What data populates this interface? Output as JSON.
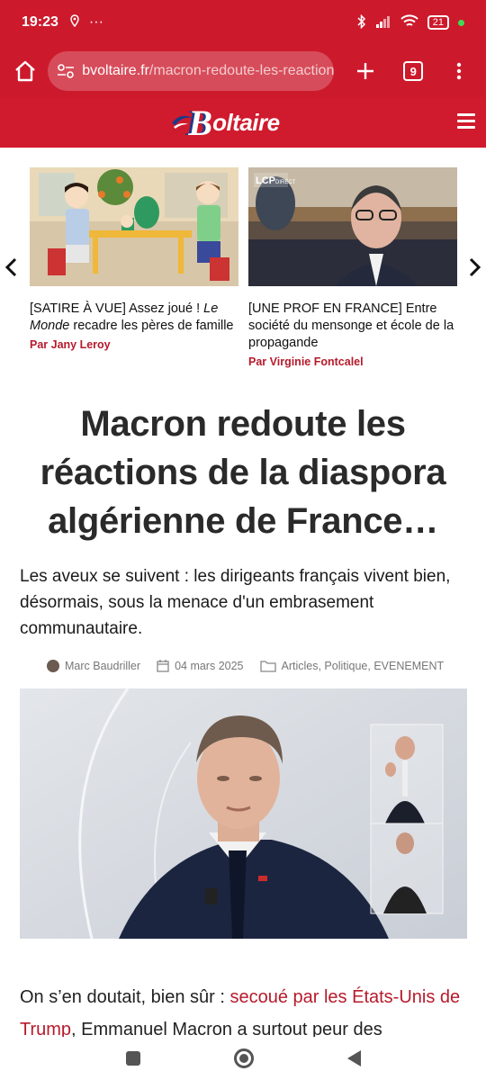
{
  "statusbar": {
    "time": "19:23",
    "dots": "···",
    "battery": "21"
  },
  "browser": {
    "url_domain": "bvoltaire.fr",
    "url_path": "/macron-redoute-les-reaction",
    "tab_count": "9"
  },
  "site": {
    "logo_letter": "B",
    "logo_text": "oltaire"
  },
  "carousel": {
    "cards": [
      {
        "caption_pre": "[SATIRE À VUE] Assez joué ! ",
        "caption_italic": "Le Monde",
        "caption_post": " recadre les pères de famille",
        "author": "Par Jany Leroy"
      },
      {
        "caption_pre": "[UNE PROF EN FRANCE] Entre société du mensonge et école de la propagande",
        "caption_italic": "",
        "caption_post": "",
        "author": "Par Virginie Fontcalel"
      }
    ]
  },
  "article": {
    "headline": "Macron redoute les réactions de la diaspora algérienne de France…",
    "dek": "Les aveux se suivent : les dirigeants français vivent bien, désormais, sous la menace d'un embrasement communautaire.",
    "author": "Marc Baudriller",
    "date": "04 mars 2025",
    "categories": "Articles, Politique, EVENEMENT",
    "body_pre": "On s’en doutait, bien sûr : ",
    "body_link": "secoué par les États-Unis de Trump",
    "body_post": ", Emmanuel Macron a surtout peur des"
  },
  "hero": {
    "badge_lcp": "LCP",
    "badge_direct": "DIRECT"
  }
}
